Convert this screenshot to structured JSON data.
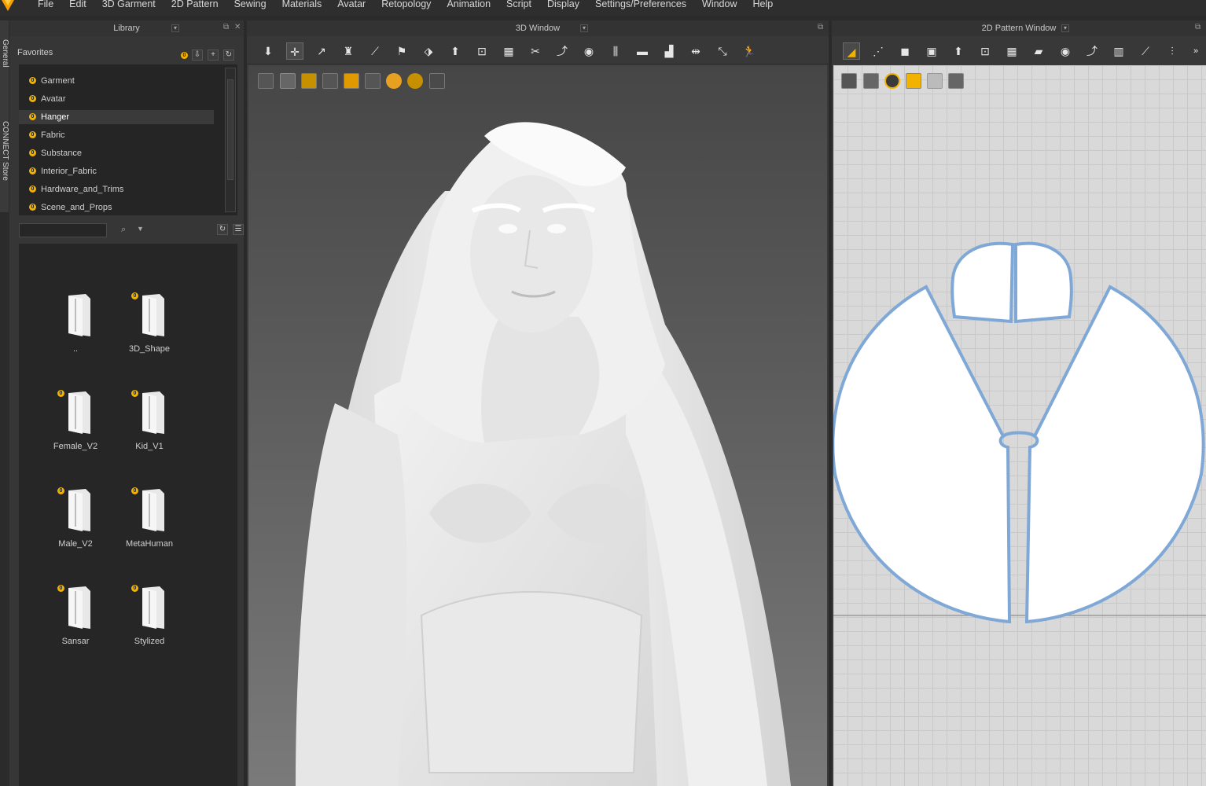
{
  "menu": [
    "File",
    "Edit",
    "3D Garment",
    "2D Pattern",
    "Sewing",
    "Materials",
    "Avatar",
    "Retopology",
    "Animation",
    "Script",
    "Display",
    "Settings/Preferences",
    "Window",
    "Help"
  ],
  "side_tabs": [
    "General",
    "CONNECT Store"
  ],
  "library": {
    "title": "Library",
    "favorites_label": "Favorites",
    "favorites": [
      "Garment",
      "Avatar",
      "Hanger",
      "Fabric",
      "Substance",
      "Interior_Fabric",
      "Hardware_and_Trims",
      "Scene_and_Props"
    ],
    "selected_favorite": "Hanger",
    "search_placeholder": "",
    "folders": [
      "..",
      "3D_Shape",
      "Female_V2",
      "Kid_V1",
      "Male_V2",
      "MetaHuman",
      "Sansar",
      "Stylized"
    ],
    "badged_folders": [
      "3D_Shape",
      "Female_V2",
      "Kid_V1",
      "Male_V2",
      "MetaHuman",
      "Sansar",
      "Stylized"
    ]
  },
  "window_3d": {
    "title": "3D Window"
  },
  "window_2d": {
    "title": "2D Pattern Window"
  },
  "colors": {
    "accent": "#f2b200",
    "pattern_outline": "#7fa8d6",
    "panel": "#363636",
    "viewport_top": "#464646"
  }
}
